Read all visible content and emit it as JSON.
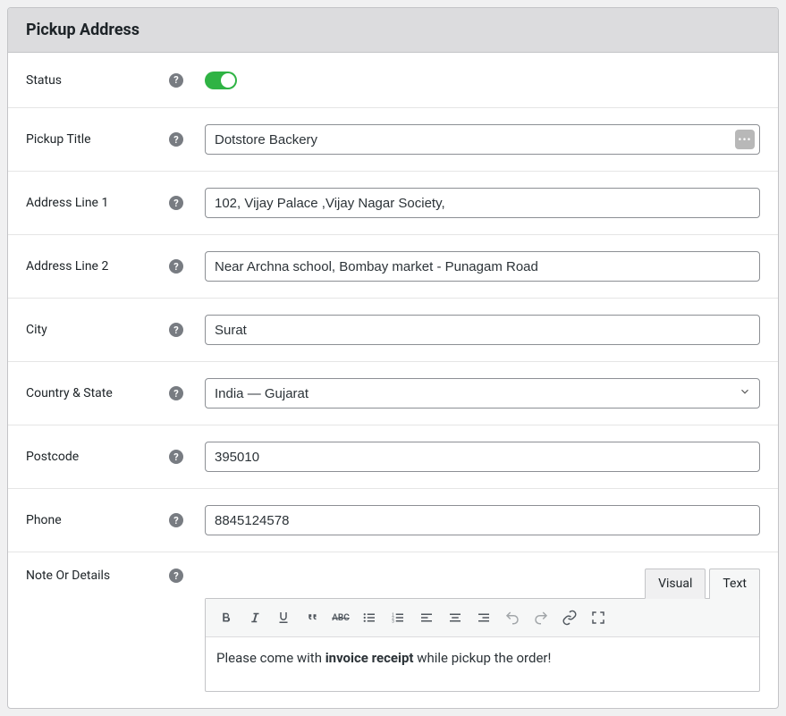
{
  "header": {
    "title": "Pickup Address"
  },
  "fields": {
    "status": {
      "label": "Status",
      "on": true
    },
    "pickup_title": {
      "label": "Pickup Title",
      "value": "Dotstore Backery"
    },
    "address1": {
      "label": "Address Line 1",
      "value": "102, Vijay Palace ,Vijay Nagar Society,"
    },
    "address2": {
      "label": "Address Line 2",
      "value": "Near Archna school, Bombay market - Punagam Road"
    },
    "city": {
      "label": "City",
      "value": "Surat"
    },
    "country_state": {
      "label": "Country & State",
      "value": "India — Gujarat"
    },
    "postcode": {
      "label": "Postcode",
      "value": "395010"
    },
    "phone": {
      "label": "Phone",
      "value": "8845124578"
    },
    "note": {
      "label": "Note Or Details"
    }
  },
  "editor": {
    "tabs": {
      "visual": "Visual",
      "text": "Text"
    },
    "content_prefix": "Please come with ",
    "content_bold": "invoice receipt",
    "content_suffix": " while pickup the order!"
  },
  "icons": {
    "help": "?",
    "dots": "•••"
  }
}
